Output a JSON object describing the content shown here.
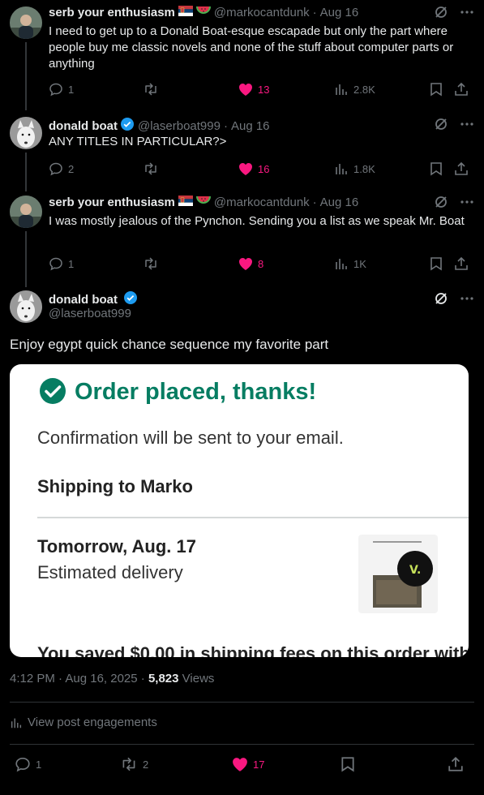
{
  "colors": {
    "like": "#f91880",
    "muted": "#71767b",
    "text": "#e7e9ea",
    "verified": "#1d9bf0",
    "order_green": "#067d62"
  },
  "tweets": [
    {
      "name": "serb your enthusiasm",
      "handle": "@markocantdunk",
      "date": "Aug 16",
      "text": "I need to get up to a Donald Boat-esque escapade but only the part where people buy me classic novels and none of the stuff about computer parts or anything",
      "replies": "1",
      "likes": "13",
      "views": "2.8K"
    },
    {
      "name": "donald boat",
      "handle": "@laserboat999",
      "date": "Aug 16",
      "text": "ANY TITLES IN PARTICULAR?>",
      "replies": "2",
      "likes": "16",
      "views": "1.8K"
    },
    {
      "name": "serb your enthusiasm",
      "handle": "@markocantdunk",
      "date": "Aug 16",
      "text": "I was mostly jealous of the Pynchon. Sending you a list as we speak Mr. Boat",
      "replies": "1",
      "likes": "8",
      "views": "1K"
    }
  ],
  "main": {
    "name": "donald boat",
    "handle": "@laserboat999",
    "text": "Enjoy egypt quick chance sequence my favorite part",
    "media": {
      "title": "Order placed, thanks!",
      "confirm": "Confirmation will be sent to your email.",
      "shipping": "Shipping to Marko",
      "delivery_date": "Tomorrow, Aug. 17",
      "delivery_label": "Estimated delivery",
      "cutoff_text": "You saved $0.00 in shipping fees on this order with"
    },
    "time": "4:12 PM · Aug 16, 2025 ·",
    "views_count": "5,823",
    "views_label": "Views",
    "engagements": "View post engagements",
    "replies": "1",
    "reposts": "2",
    "likes": "17"
  }
}
